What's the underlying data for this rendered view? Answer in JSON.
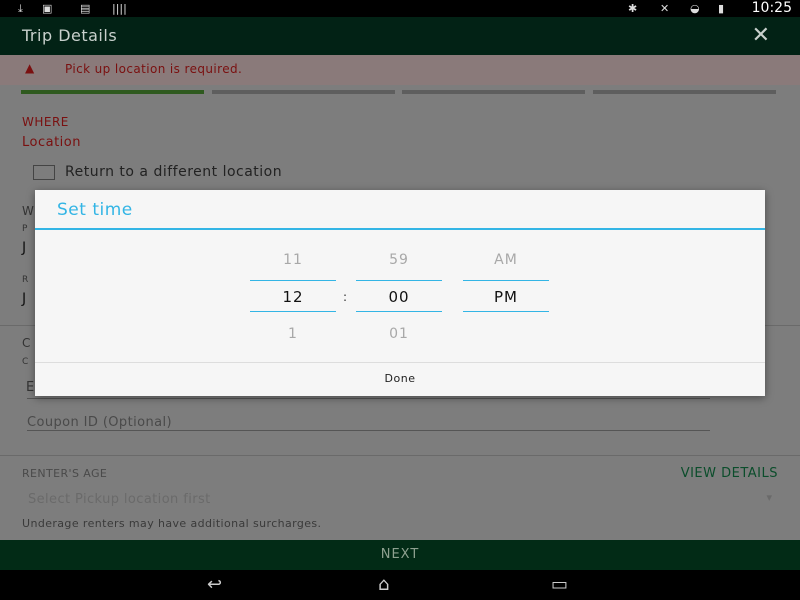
{
  "status_bar": {
    "time": "10:25",
    "left_icons": [
      "download-icon",
      "voicemail-icon",
      "print-icon",
      "barcode-icon"
    ],
    "right_icons": [
      "bluetooth-icon",
      "mute-icon",
      "wifi-icon",
      "battery-icon"
    ]
  },
  "toolbar": {
    "title": "Trip Details",
    "close_icon": "close-icon"
  },
  "error": {
    "message": "Pick up location is required."
  },
  "progress": {
    "steps": 4,
    "current_step": 1
  },
  "where": {
    "section_label": "WHERE",
    "location_label": "Location",
    "return_checkbox_label": "Return to a different location"
  },
  "background_fragments": {
    "w": "W",
    "p": "P",
    "j1": "J",
    "r": "R",
    "j2": "J",
    "c": "C",
    "c2": "C",
    "e": "E"
  },
  "coupon": {
    "placeholder": "Coupon ID (Optional)"
  },
  "renter_age": {
    "label": "RENTER'S AGE",
    "view_details": "VIEW DETAILS",
    "select_placeholder": "Select Pickup location first",
    "note": "Underage renters may have additional surcharges."
  },
  "next_button": "NEXT",
  "dialog": {
    "title": "Set time",
    "hour": {
      "prev": "11",
      "current": "12",
      "next": "1"
    },
    "minute": {
      "prev": "59",
      "current": "00",
      "next": "01"
    },
    "ampm": {
      "prev": "AM",
      "current": "PM",
      "next": ""
    },
    "separator": ":",
    "done_label": "Done"
  },
  "colors": {
    "accent_blue": "#33b5e5",
    "toolbar_dark_green": "#022215",
    "error_red": "#7a1010",
    "view_details_green": "#0b4d2b"
  }
}
